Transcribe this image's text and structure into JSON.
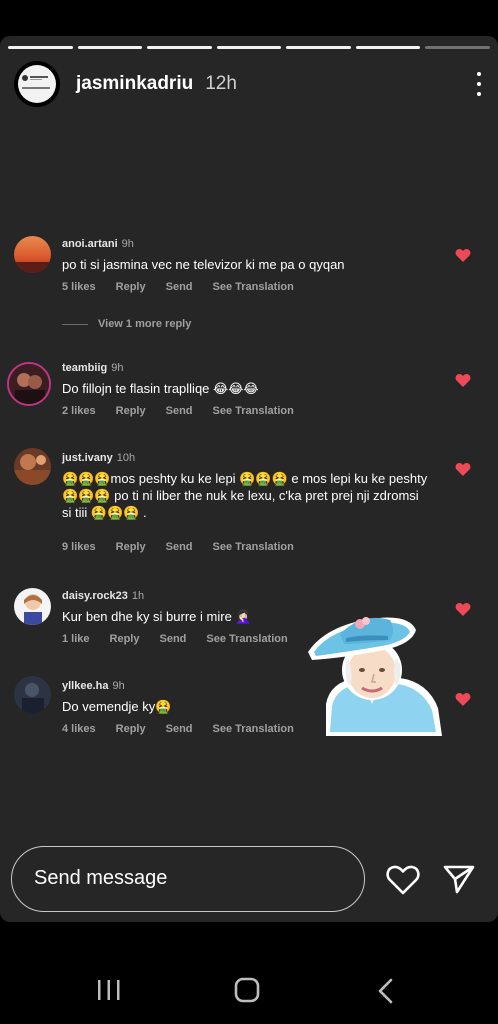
{
  "story": {
    "username": "jasminkadriu",
    "time_ago": "12h",
    "progress_segments": 7,
    "progress_current_segment": 7
  },
  "comments": [
    {
      "username": "anoi.artani",
      "time": "9h",
      "text": "po ti si jasmina vec ne televizor ki me pa o qyqan",
      "likes": "5 likes",
      "reply": "Reply",
      "send": "Send",
      "translate": "See Translation",
      "liked": true
    },
    {
      "username": "teambiig",
      "time": "9h",
      "text": "Do fillojn te flasin traplliqe 😂😂😂",
      "likes": "2 likes",
      "reply": "Reply",
      "send": "Send",
      "translate": "See Translation",
      "liked": true
    },
    {
      "username": "just.ivany",
      "time": "10h",
      "text": "🤮🤮🤮mos peshty ku ke lepi 🤮🤮🤮 e mos lepi ku ke peshty 🤮🤮🤮 po ti ni liber the nuk ke lexu, c'ka pret prej nji zdromsi si tiii 🤮🤮🤮 .",
      "likes": "9 likes",
      "reply": "Reply",
      "send": "Send",
      "translate": "See Translation",
      "liked": true
    },
    {
      "username": "daisy.rock23",
      "time": "1h",
      "text": "Kur ben dhe ky si burre i mire 🤦🏻‍♀️",
      "likes": "1 like",
      "reply": "Reply",
      "send": "Send",
      "translate": "See Translation",
      "liked": true
    },
    {
      "username": "yllkee.ha",
      "time": "9h",
      "text": "Do vemendje ky🤮",
      "likes": "4 likes",
      "reply": "Reply",
      "send": "Send",
      "translate": "See Translation",
      "liked": true
    }
  ],
  "view_more_reply": "View 1 more reply",
  "message_input": {
    "placeholder": "Send message"
  },
  "icons": {
    "like": "heart-icon",
    "share": "paper-plane-icon",
    "menu": "more-vertical-icon",
    "comment_like": "heart-filled-icon",
    "nav_recent": "recent-apps-icon",
    "nav_home": "home-icon",
    "nav_back": "back-icon"
  },
  "colors": {
    "story_background": "#262626",
    "like_red": "#ed4956",
    "secondary_text": "#a0a0a0"
  }
}
